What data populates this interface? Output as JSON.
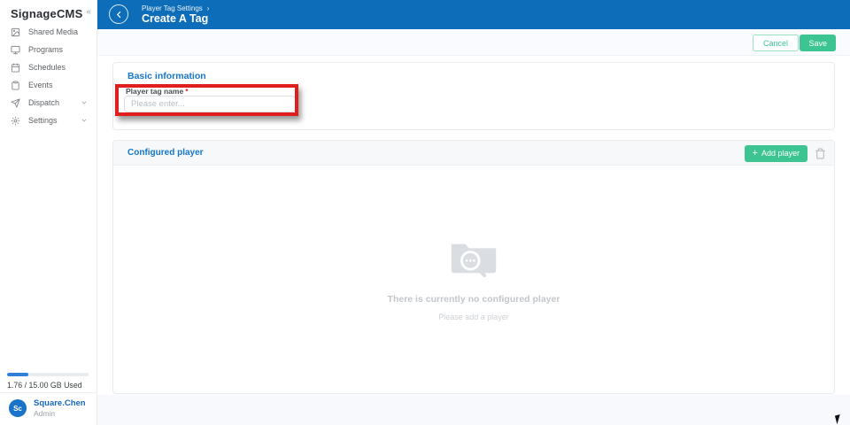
{
  "sidebar": {
    "logo": "SignageCMS",
    "collapse_glyph": "«",
    "items": [
      {
        "label": "Shared Media",
        "icon": "image-icon"
      },
      {
        "label": "Programs",
        "icon": "monitor-icon"
      },
      {
        "label": "Schedules",
        "icon": "calendar-icon"
      },
      {
        "label": "Events",
        "icon": "clipboard-icon"
      },
      {
        "label": "Dispatch",
        "icon": "send-icon",
        "expandable": true
      },
      {
        "label": "Settings",
        "icon": "gear-icon",
        "expandable": true
      }
    ],
    "storage": {
      "used_label": "1.76 / 15.00 GB Used",
      "bar_style": "width:26%"
    },
    "user": {
      "initials": "Sc",
      "name": "Square.Chen",
      "role": "Admin"
    }
  },
  "header": {
    "breadcrumb": "Player Tag Settings",
    "breadcrumb_separator": "›",
    "title": "Create A Tag"
  },
  "toolbar": {
    "cancel_label": "Cancel",
    "save_label": "Save"
  },
  "basic_info": {
    "title": "Basic information",
    "field_label": "Player tag name",
    "required_mark": "*",
    "placeholder": "Please enter..."
  },
  "configured_player": {
    "title": "Configured player",
    "add_plus": "+",
    "add_button_label": "Add player",
    "empty_title": "There is currently no configured player",
    "empty_subtitle": "Please add a player"
  },
  "colors": {
    "header_blue": "#0d6db8",
    "section_blue": "#1677c8",
    "accent_green": "#3cc492",
    "highlight_red": "#e01e1e"
  }
}
